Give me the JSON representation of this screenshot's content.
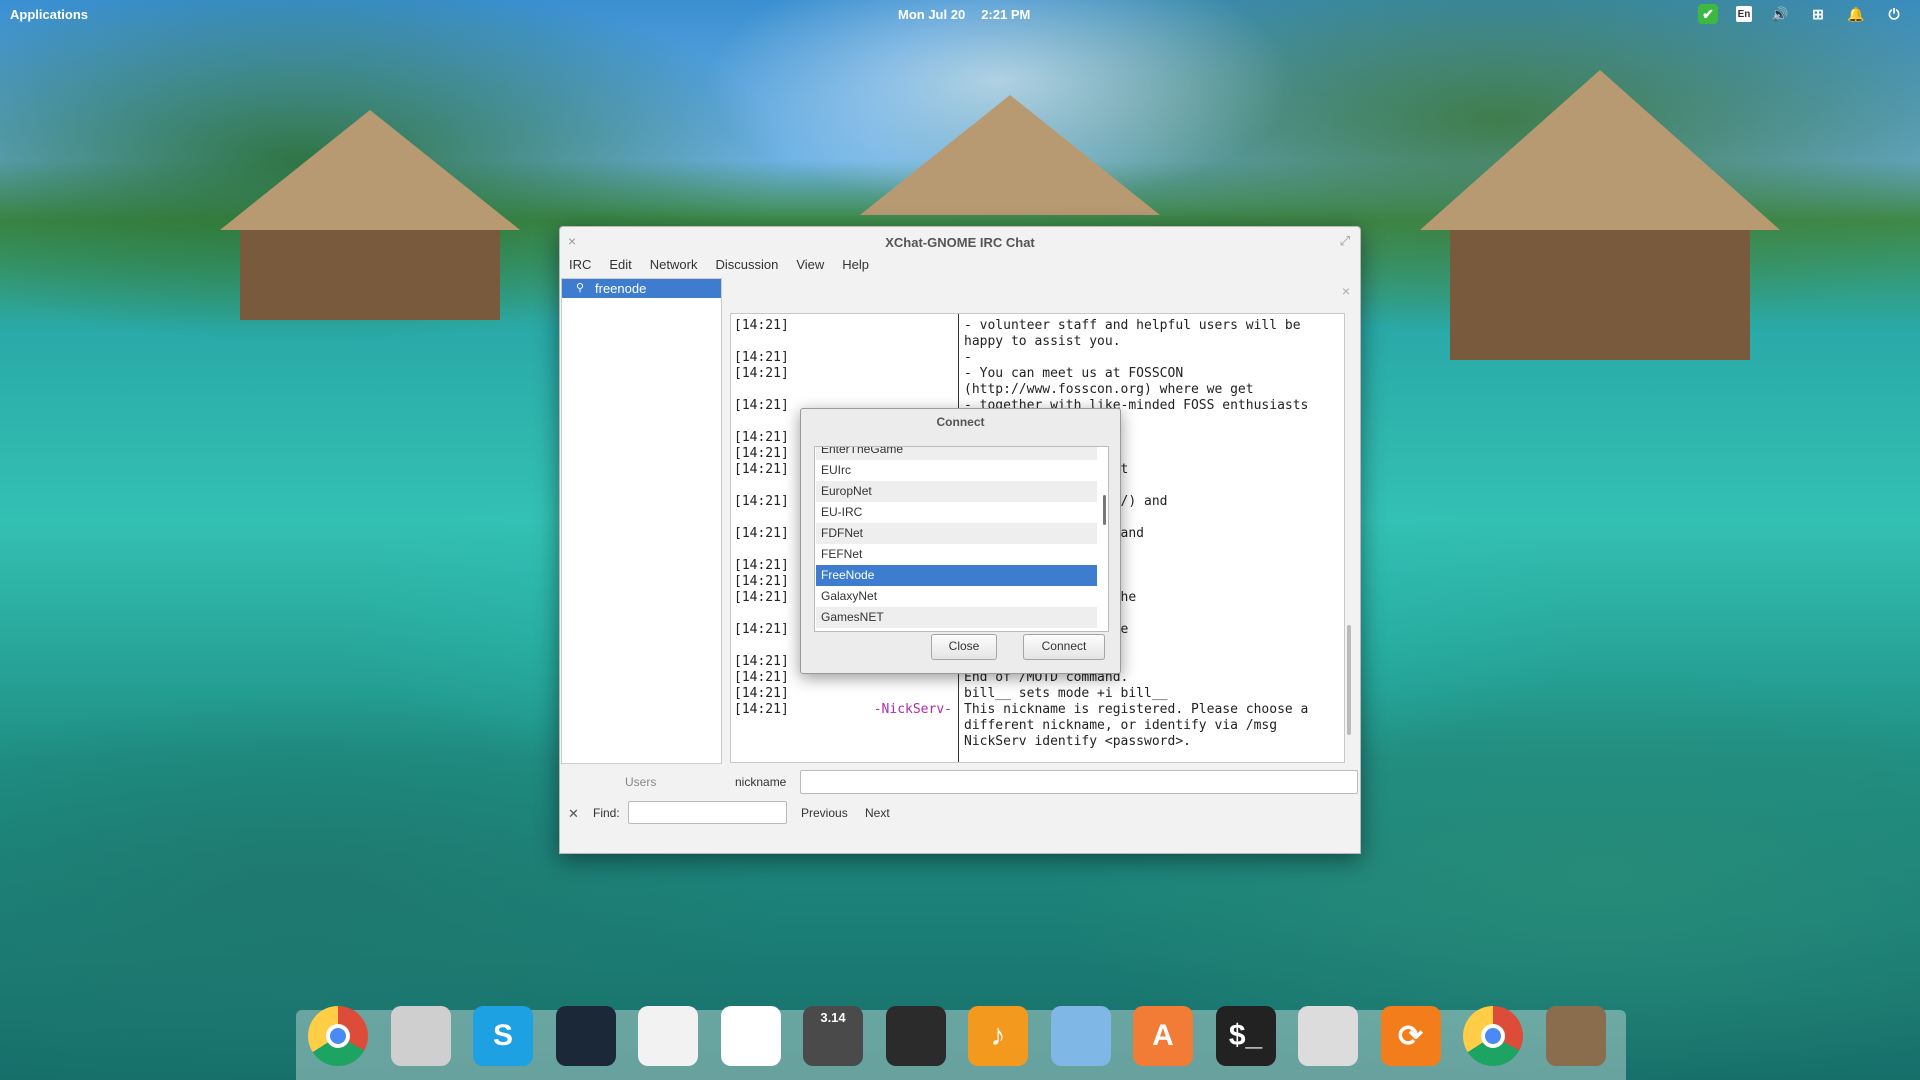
{
  "topbar": {
    "applications": "Applications",
    "date": "Mon Jul 20",
    "time": "2:21 PM",
    "tray": [
      {
        "icon": "check-shield-icon"
      },
      {
        "icon": "keyboard-layout-icon",
        "label": "En"
      },
      {
        "icon": "volume-icon"
      },
      {
        "icon": "network-icon"
      },
      {
        "icon": "notifications-icon"
      },
      {
        "icon": "power-icon"
      }
    ]
  },
  "window": {
    "title": "XChat-GNOME IRC Chat",
    "menu": [
      "IRC",
      "Edit",
      "Network",
      "Discussion",
      "View",
      "Help"
    ],
    "networks": [
      {
        "label": "freenode",
        "selected": true
      }
    ],
    "chat": [
      {
        "ts": "[14:21]",
        "nick": "",
        "msg": "- volunteer staff and helpful users will be"
      },
      {
        "ts": "",
        "nick": "",
        "msg": "happy to assist you."
      },
      {
        "ts": "[14:21]",
        "nick": "",
        "msg": "-"
      },
      {
        "ts": "[14:21]",
        "nick": "",
        "msg": "- You can meet us at FOSSCON"
      },
      {
        "ts": "",
        "nick": "",
        "msg": "(http://www.fosscon.org) where we get"
      },
      {
        "ts": "[14:21]",
        "nick": "",
        "msg": "- together with like-minded FOSS enthusiasts"
      },
      {
        "ts": "",
        "nick": "",
        "msg": ""
      },
      {
        "ts": "[14:21]",
        "nick": "",
        "msg": "ation."
      },
      {
        "ts": "[14:21]",
        "nick": "",
        "msg": ""
      },
      {
        "ts": "[14:21]",
        "nick": "",
        "msg": "hank Private Internet"
      },
      {
        "ts": "",
        "nick": "",
        "msg": ""
      },
      {
        "ts": "[14:21]",
        "nick": "",
        "msg": "teinternetaccess.com/) and"
      },
      {
        "ts": "",
        "nick": "",
        "msg": ""
      },
      {
        "ts": "[14:21]",
        "nick": "",
        "msg": " help keep freenode and"
      },
      {
        "ts": "",
        "nick": "",
        "msg": ""
      },
      {
        "ts": "[14:21]",
        "nick": "",
        "msg": "sustained support."
      },
      {
        "ts": "[14:21]",
        "nick": "",
        "msg": ""
      },
      {
        "ts": "[14:21]",
        "nick": "",
        "msg": "ould like to thank the"
      },
      {
        "ts": "",
        "nick": "",
        "msg": ""
      },
      {
        "ts": "[14:21]",
        "nick": "",
        "msg": "tails of which can be"
      },
      {
        "ts": "",
        "nick": "",
        "msg": ""
      },
      {
        "ts": "[14:21]",
        "nick": "",
        "msg": ""
      },
      {
        "ts": "[14:21]",
        "nick": "",
        "msg": "End of /MOTD command."
      },
      {
        "ts": "[14:21]",
        "nick": "",
        "msg": "bill__ sets mode +i bill__"
      },
      {
        "ts": "[14:21]",
        "nick": "-NickServ-",
        "msg": "This nickname is registered. Please choose a"
      },
      {
        "ts": "",
        "nick": "",
        "msg": "different nickname, or identify via /msg"
      },
      {
        "ts": "",
        "nick": "",
        "msg": "NickServ identify <password>."
      }
    ],
    "users_label": "Users",
    "nickname_label": "nickname",
    "input_value": "",
    "find_label": "Find:",
    "find_value": "",
    "previous": "Previous",
    "next": "Next"
  },
  "dialog": {
    "title": "Connect",
    "networks": [
      "EnterTheGame",
      "EUIrc",
      "EuropNet",
      "EU-IRC",
      "FDFNet",
      "FEFNet",
      "FreeNode",
      "GalaxyNet",
      "GamesNET"
    ],
    "selected": "FreeNode",
    "close": "Close",
    "connect": "Connect"
  },
  "dock": [
    {
      "name": "chrome-icon",
      "color": "#dd4b39"
    },
    {
      "name": "home-folder-icon",
      "color": "#cfcfcf"
    },
    {
      "name": "skype-icon",
      "color": "#1da1e2",
      "label": "S"
    },
    {
      "name": "steam-icon",
      "color": "#1b2838"
    },
    {
      "name": "calendar-icon",
      "color": "#f2f2f2"
    },
    {
      "name": "document-viewer-icon",
      "color": "#ffffff"
    },
    {
      "name": "calculator-icon",
      "color": "#4a4a4a",
      "label": "3.14"
    },
    {
      "name": "screenshot-icon",
      "color": "#2b2b2b"
    },
    {
      "name": "music-icon",
      "color": "#f39a1e",
      "label": "♪"
    },
    {
      "name": "photos-icon",
      "color": "#7fb7e6"
    },
    {
      "name": "app-center-icon",
      "color": "#f27b35",
      "label": "A"
    },
    {
      "name": "terminal-icon",
      "color": "#222222",
      "label": "$_"
    },
    {
      "name": "switchboard-icon",
      "color": "#dcdcdc"
    },
    {
      "name": "update-icon",
      "color": "#f37d1b",
      "label": "⟳"
    },
    {
      "name": "chrome-icon",
      "color": "#dd4b39"
    },
    {
      "name": "gimp-icon",
      "color": "#8a6d4c"
    }
  ]
}
